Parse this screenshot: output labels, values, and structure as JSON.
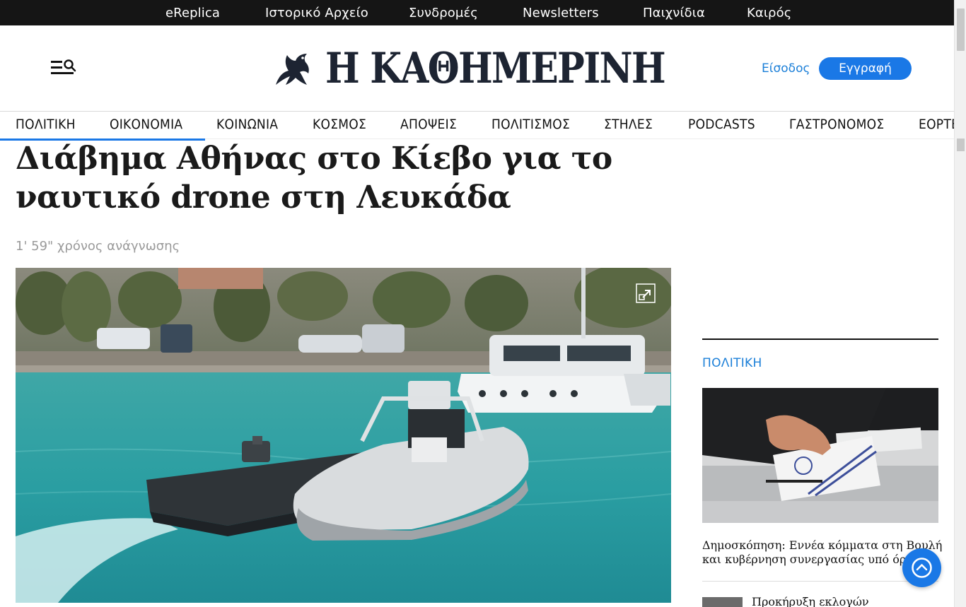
{
  "topbar": {
    "links": [
      "eReplica",
      "Ιστορικό Αρχείο",
      "Συνδρομές",
      "Newsletters",
      "Παιχνίδια",
      "Καιρός"
    ]
  },
  "header": {
    "logo_text": "Η ΚΑΘΗΜΕΡΙΝΗ",
    "login_label": "Είσοδος",
    "register_label": "Εγγραφή"
  },
  "nav": {
    "items": [
      "ΠΟΛΙΤΙΚΗ",
      "ΟΙΚΟΝΟΜΙΑ",
      "ΚΟΙΝΩΝΙΑ",
      "ΚΟΣΜΟΣ",
      "ΑΠΟΨΕΙΣ",
      "ΠΟΛΙΤΙΣΜΟΣ",
      "ΣΤΗΛΕΣ",
      "PODCASTS",
      "ΓΑΣΤΡΟΝΟΜΟΣ",
      "ΕΟΡΤΕΣ"
    ]
  },
  "article": {
    "headline_line1": "Διάβημα Αθήνας στο Κίεβο για το",
    "headline_line2": "ναυτικό drone στη Λευκάδα",
    "read_time": "1' 59\" χρόνος ανάγνωσης"
  },
  "sidebar": {
    "category": "ΠΟΛΙΤΙΚΗ",
    "story1_title": "Δημοσκόπηση: Εννέα κόμματα στη Βουλή και κυβέρνηση συνεργασίας υπό όρους",
    "story2_title": "Προκήρυξη εκλογών"
  },
  "colors": {
    "accent": "#1a78e6",
    "link": "#1b7fd8",
    "topbar_bg": "#151515",
    "logo": "#1d2432"
  },
  "icons": {
    "menu": "menu-search-icon",
    "expand": "expand-icon",
    "to_top": "chevron-up-icon"
  }
}
